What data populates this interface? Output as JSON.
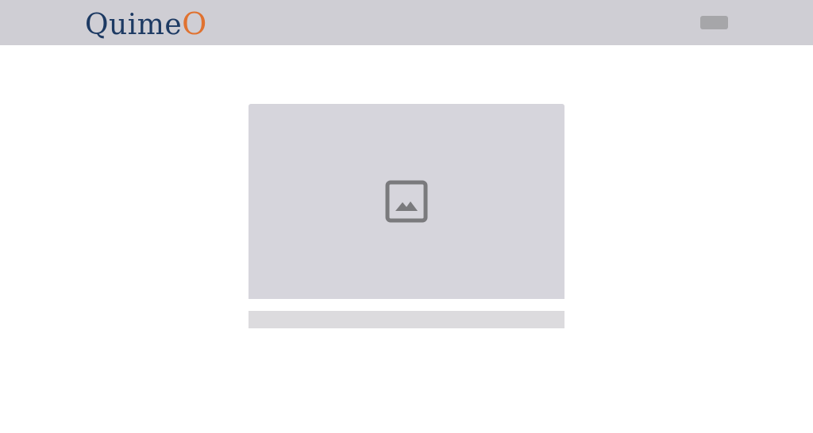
{
  "header": {
    "logo_main": "Quime",
    "logo_accent": "O",
    "colors": {
      "bar": "#cfced4",
      "logo_main": "#1d3a63",
      "logo_accent": "#e07230"
    },
    "menu_button_icon": "menu-placeholder"
  },
  "main": {
    "media_card": {
      "image_icon": "image-icon",
      "placeholder_color": "#d6d5dc",
      "caption_bar_color": "#dcdbde"
    }
  }
}
